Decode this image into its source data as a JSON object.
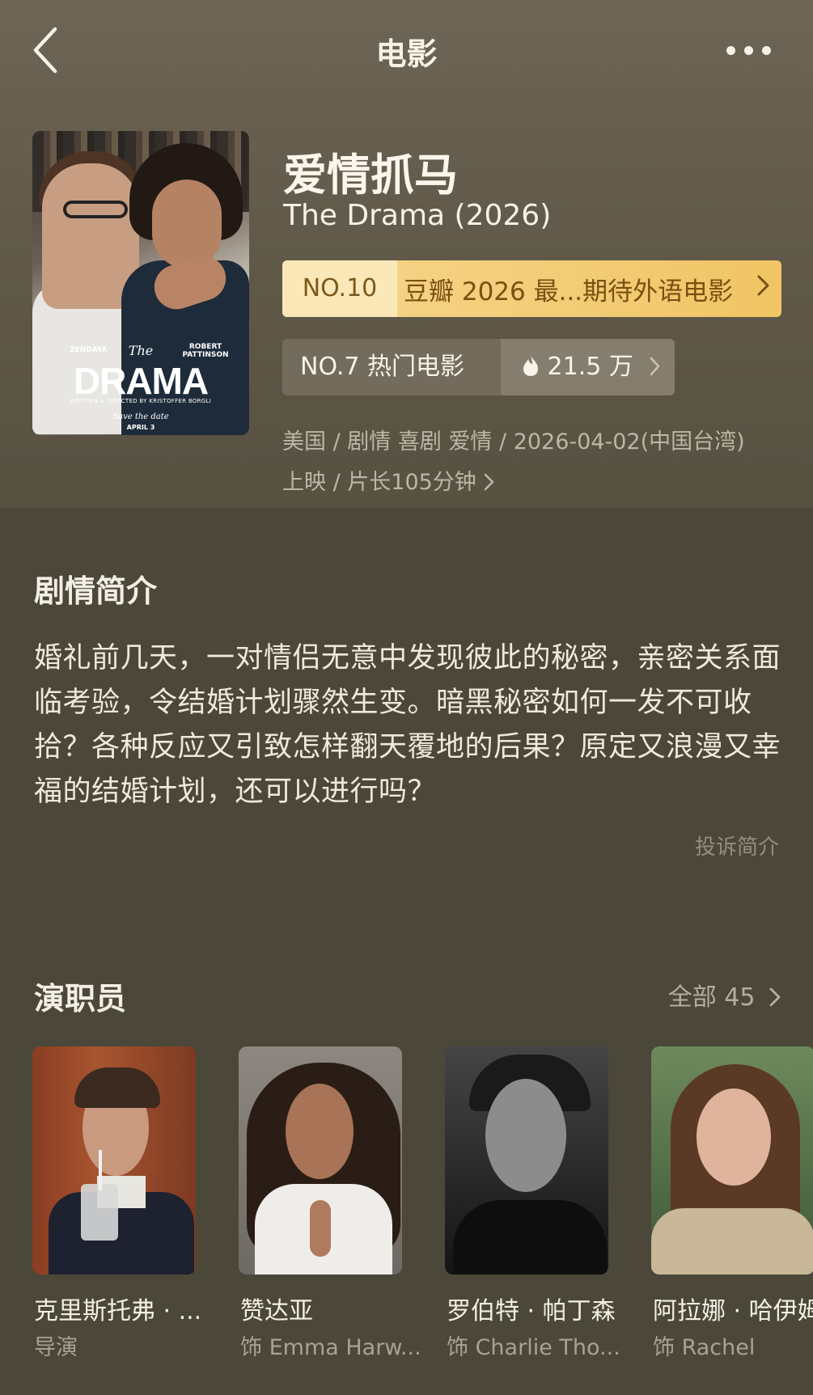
{
  "nav": {
    "title": "电影"
  },
  "movie": {
    "title_cn": "爱情抓马",
    "title_en": "The Drama (2026)",
    "poster": {
      "name_left": "ZENDAYA",
      "name_right": "ROBERT PATTINSON",
      "the": "The",
      "title": "DRAMA",
      "credit": "WRITTEN & DIRECTED BY KRISTOFFER BORGLI",
      "save": "Save the date",
      "date": "APRIL 3"
    },
    "rank_douban": {
      "no": "NO.10",
      "label": "豆瓣 2026 最...期待外语电影"
    },
    "rank_hot": {
      "no": "NO.7 热门电影",
      "heat": "21.5 万"
    },
    "meta": "美国 / 剧情 喜剧 爱情 / 2026-04-02(中国台湾) 上映 / 片长105分钟"
  },
  "synopsis": {
    "heading": "剧情简介",
    "text": "婚礼前几天，一对情侣无意中发现彼此的秘密，亲密关系面临考验，令结婚计划骤然生变。暗黑秘密如何一发不可收拾？各种反应又引致怎样翻天覆地的后果？原定又浪漫又幸福的结婚计划，还可以进行吗？",
    "report": "投诉简介"
  },
  "cast": {
    "heading": "演职员",
    "all_label": "全部 45",
    "items": [
      {
        "name": "克里斯托弗 · ...",
        "role": "导演"
      },
      {
        "name": "赞达亚",
        "role": "饰 Emma Harw..."
      },
      {
        "name": "罗伯特 · 帕丁森",
        "role": "饰 Charlie Tho..."
      },
      {
        "name": "阿拉娜 · 哈伊姆",
        "role": "饰 Rachel"
      }
    ]
  },
  "colors": {
    "background": "#4b4739",
    "gold": "#f0c565",
    "gold_text": "#7a4f10"
  },
  "icons": [
    "back-arrow-icon",
    "more-dots-icon",
    "flame-icon",
    "chevron-right-icon"
  ]
}
